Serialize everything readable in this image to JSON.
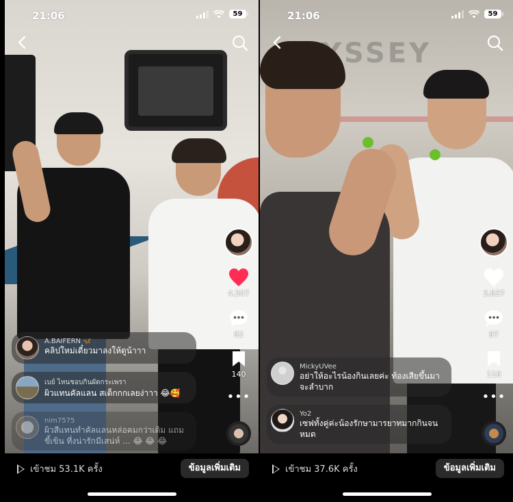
{
  "panels": [
    {
      "status": {
        "time": "21:06",
        "battery": "59"
      },
      "likes": "4,507",
      "comments_count": "82",
      "saves": "140",
      "comments": [
        {
          "user": "A.BAIFERN 🦋",
          "text": "คลิปใหม่เดี๋ยวมาลงให้ดูน้าาา"
        },
        {
          "user": "เบย์ ไหนชอบกินผัดกระเพรา",
          "text": "ผิวแทนคัลแลน สเต็กกกเลยง่าาา 😂🥰"
        },
        {
          "user": "nim7575",
          "text": "ผิวสีแทนทำคัลแลนหล่อคมกว่าเดิม แถมขี้เขิน ที่งน่ารักมีเสน่ห์ ... 😂 😂 😂"
        }
      ],
      "views": "เข้าชม 53.1K ครั้ง",
      "info_button": "ข้อมูลเพิ่มเติม",
      "liked": true,
      "like_color": "#ff2d55"
    },
    {
      "status": {
        "time": "21:06",
        "battery": "59"
      },
      "likes": "3,637",
      "comments_count": "97",
      "saves": "116",
      "comments": [
        {
          "user": "MickyUVee",
          "text": "อย่าให้อะไรน้องกินเลยค่ะ ท้องเสียขึ้นมาจะลำบาก"
        },
        {
          "user": "Yo2",
          "text": "เซฟทั้งคู่ค่ะน้องรักษามารยาทมากกินจนหมด"
        }
      ],
      "views": "เข้าชม 37.6K ครั้ง",
      "info_button": "ข้อมูลเพิ่มเติม",
      "liked": false
    }
  ],
  "icons": {
    "back": "chevron-left-icon",
    "search": "search-icon",
    "like": "heart-icon",
    "comment": "comment-bubble-icon",
    "save": "bookmark-icon",
    "more": "more-dots-icon",
    "views": "play-icon"
  }
}
